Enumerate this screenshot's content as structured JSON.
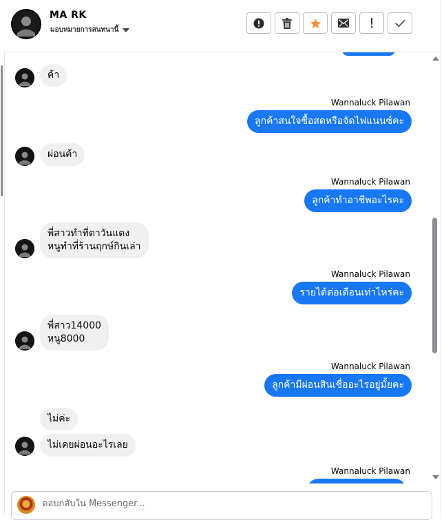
{
  "contact": {
    "name": "MA RK",
    "assignment_label": "มอบหมายการสนทนานี้"
  },
  "actions": [
    {
      "name": "report-spam-button",
      "icon": "alert-circle-icon"
    },
    {
      "name": "delete-button",
      "icon": "trash-icon"
    },
    {
      "name": "star-button",
      "icon": "star-icon",
      "color": "#f7923a"
    },
    {
      "name": "mark-unread-button",
      "icon": "envelope-icon"
    },
    {
      "name": "follow-up-button",
      "icon": "exclamation-icon"
    },
    {
      "name": "mark-done-button",
      "icon": "check-icon"
    }
  ],
  "messages": [
    {
      "type": "in",
      "text": "ค้า"
    },
    {
      "type": "out",
      "sender": "Wannaluck Pilawan",
      "text": "ลูกค้าสนใจซื้อสดหรือจัดไฟแนนซ์คะ"
    },
    {
      "type": "in",
      "text": "ผ่อนค้า"
    },
    {
      "type": "out",
      "sender": "Wannaluck Pilawan",
      "text": "ลูกค้าทำอาชีพอะไรคะ"
    },
    {
      "type": "in",
      "lines": [
        "พี่สาวทำที่ตาวันแดง",
        "หนูทำที่ร้านฤกษ์กินเล่า"
      ]
    },
    {
      "type": "out",
      "sender": "Wannaluck Pilawan",
      "text": "รายได้ต่อเดือนเท่าไหร่คะ"
    },
    {
      "type": "in",
      "lines": [
        "พี่สาว14000",
        "หนู8000"
      ]
    },
    {
      "type": "out",
      "sender": "Wannaluck Pilawan",
      "text": "ลูกค้ามีผ่อนสินเชื่ออะไรอยู่มั้ยคะ"
    },
    {
      "type": "in",
      "text": "ไม่ค่ะ"
    },
    {
      "type": "in",
      "text": "ไม่เคยผ่อนอะไรเลย"
    },
    {
      "type": "out",
      "sender": "Wannaluck Pilawan",
      "text": ""
    }
  ],
  "composer": {
    "placeholder": "ตอบกลับใน Messenger..."
  },
  "colors": {
    "outgoing_bubble": "#1877f2",
    "incoming_bubble": "#f0f0f0",
    "star": "#f7923a"
  }
}
